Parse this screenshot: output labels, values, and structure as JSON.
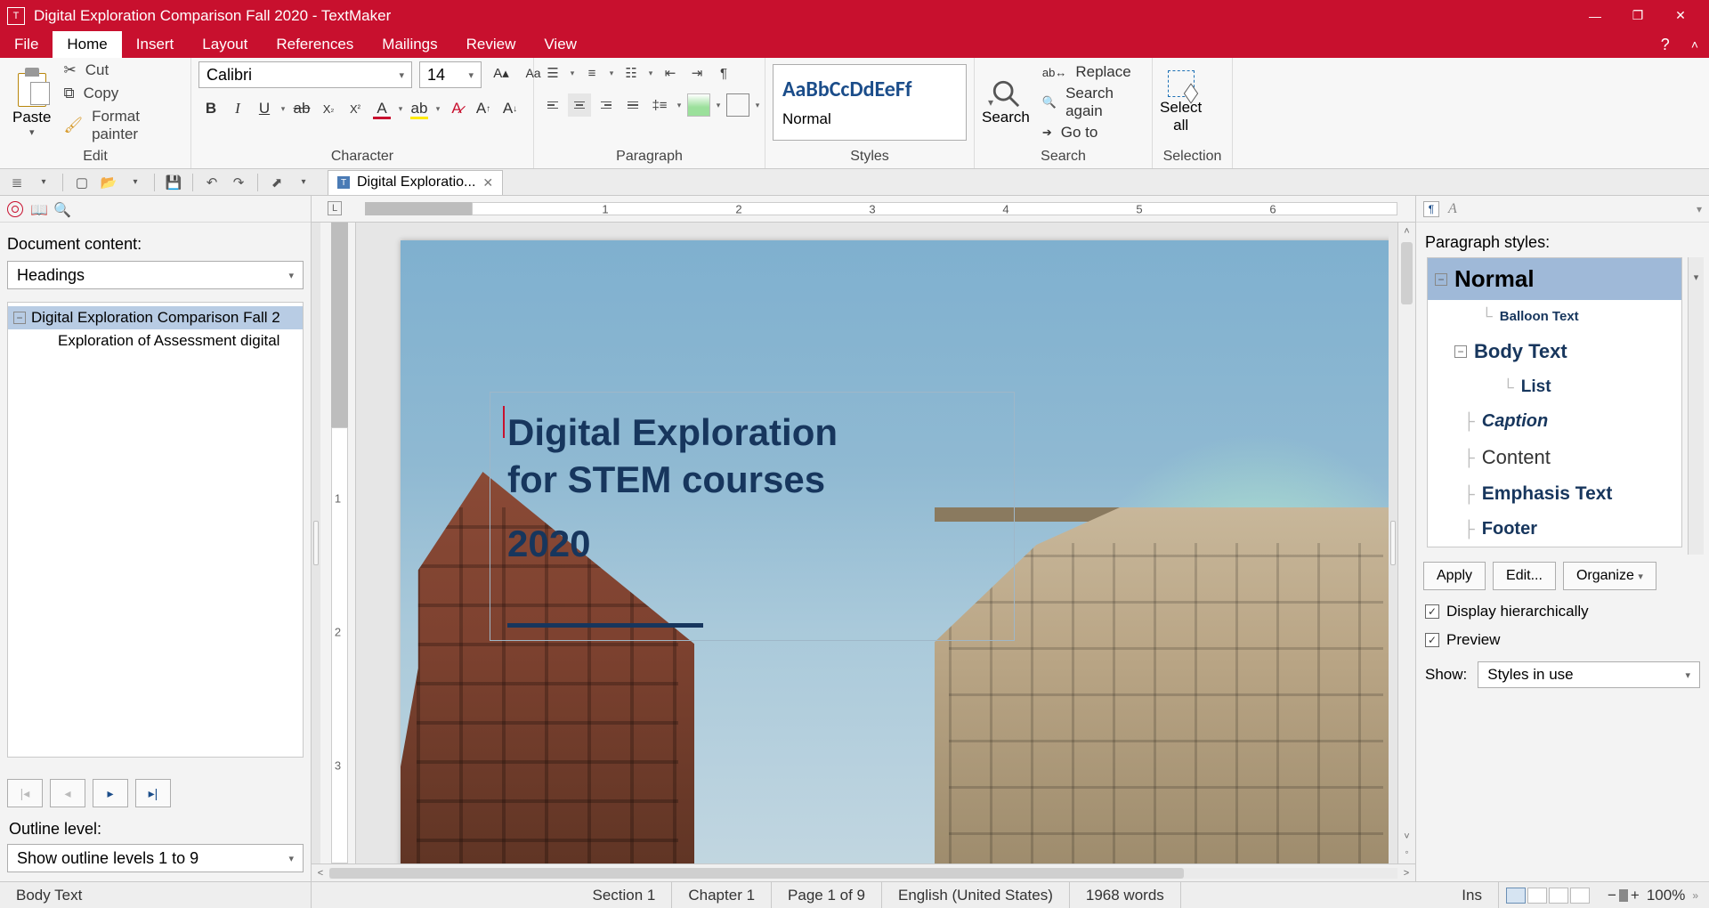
{
  "title": "Digital Exploration Comparison Fall 2020 - TextMaker",
  "menu": {
    "file": "File",
    "home": "Home",
    "insert": "Insert",
    "layout": "Layout",
    "references": "References",
    "mailings": "Mailings",
    "review": "Review",
    "view": "View"
  },
  "ribbon": {
    "edit": {
      "label": "Edit",
      "paste": "Paste",
      "cut": "Cut",
      "copy": "Copy",
      "format_painter": "Format painter"
    },
    "character": {
      "label": "Character",
      "font": "Calibri",
      "size": "14"
    },
    "paragraph": {
      "label": "Paragraph"
    },
    "styles": {
      "label": "Styles",
      "sample": "AaBbCcDdEeFf",
      "name": "Normal"
    },
    "search": {
      "label": "Search",
      "search": "Search",
      "replace": "Replace",
      "search_again": "Search again",
      "goto": "Go to"
    },
    "selection": {
      "label": "Selection",
      "select_all": "Select\nall"
    }
  },
  "doc_tab": "Digital Exploratio...",
  "ruler_h": {
    "marks": [
      "1",
      "2",
      "3",
      "4",
      "5",
      "6"
    ]
  },
  "ruler_v": {
    "marks": [
      "1",
      "2",
      "3"
    ]
  },
  "left_panel": {
    "content_label": "Document content:",
    "headings": "Headings",
    "tree_root": "Digital Exploration Comparison Fall 2",
    "tree_child": "Exploration of Assessment digital",
    "outline_label": "Outline level:",
    "outline_value": "Show outline levels 1 to 9"
  },
  "document": {
    "title_line1": "Digital Exploration",
    "title_line2": "for STEM courses",
    "year": "2020"
  },
  "right_panel": {
    "label": "Paragraph styles:",
    "styles": {
      "normal": "Normal",
      "balloon": "Balloon Text",
      "body": "Body Text",
      "list": "List",
      "caption": "Caption",
      "content": "Content",
      "emphasis": "Emphasis Text",
      "footer": "Footer"
    },
    "apply": "Apply",
    "edit": "Edit...",
    "organize": "Organize",
    "hier": "Display hierarchically",
    "preview": "Preview",
    "show": "Show:",
    "show_value": "Styles in use"
  },
  "status": {
    "style": "Body Text",
    "section": "Section 1",
    "chapter": "Chapter 1",
    "page": "Page 1 of 9",
    "lang": "English (United States)",
    "words": "1968 words",
    "ins": "Ins",
    "zoom": "100%"
  }
}
